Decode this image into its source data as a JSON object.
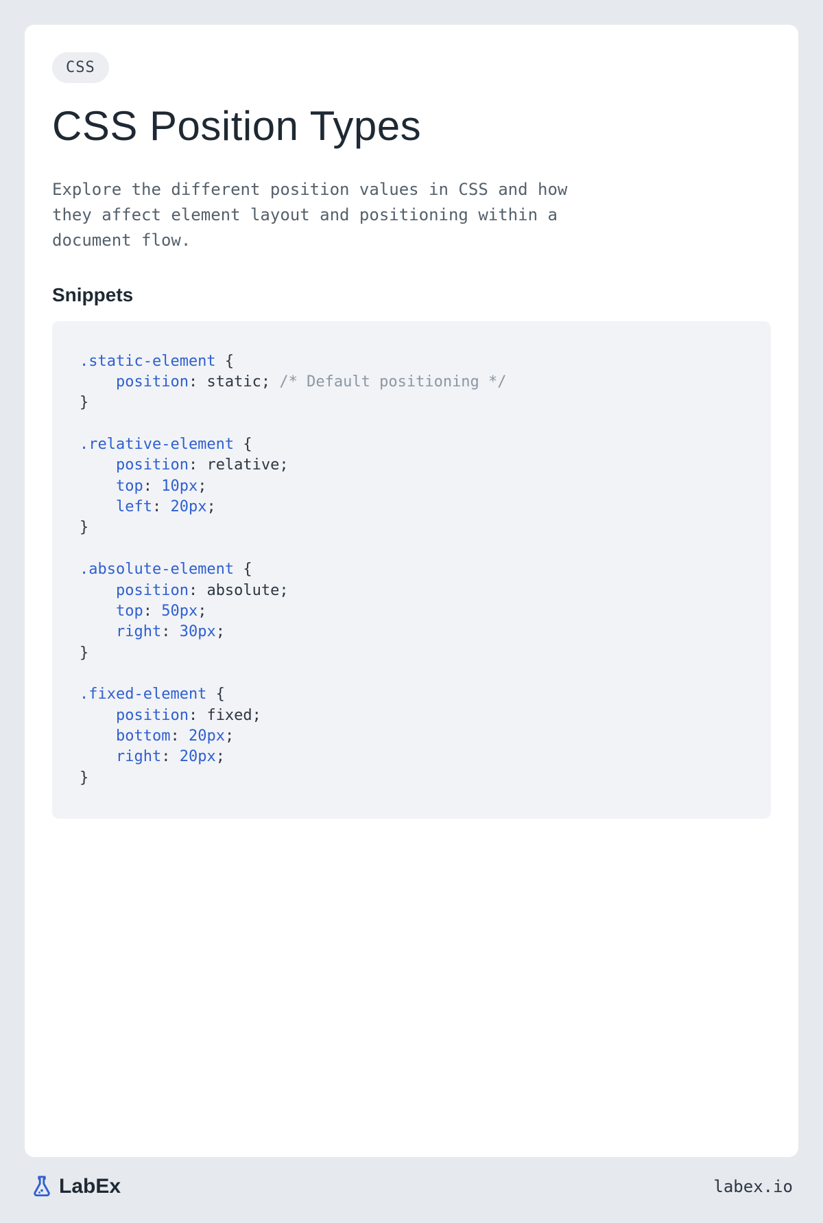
{
  "badge": "CSS",
  "title": "CSS Position Types",
  "description": "Explore the different position values in CSS and how they affect element layout and positioning within a document flow.",
  "section_heading": "Snippets",
  "code_tokens": [
    {
      "t": "sel",
      "v": ".static-element"
    },
    {
      "t": "p",
      "v": " {\n"
    },
    {
      "t": "p",
      "v": "    "
    },
    {
      "t": "prop",
      "v": "position"
    },
    {
      "t": "p",
      "v": ": static; "
    },
    {
      "t": "com",
      "v": "/* Default positioning */"
    },
    {
      "t": "p",
      "v": "\n}\n\n"
    },
    {
      "t": "sel",
      "v": ".relative-element"
    },
    {
      "t": "p",
      "v": " {\n"
    },
    {
      "t": "p",
      "v": "    "
    },
    {
      "t": "prop",
      "v": "position"
    },
    {
      "t": "p",
      "v": ": relative;\n"
    },
    {
      "t": "p",
      "v": "    "
    },
    {
      "t": "prop",
      "v": "top"
    },
    {
      "t": "p",
      "v": ": "
    },
    {
      "t": "num",
      "v": "10px"
    },
    {
      "t": "p",
      "v": ";\n"
    },
    {
      "t": "p",
      "v": "    "
    },
    {
      "t": "prop",
      "v": "left"
    },
    {
      "t": "p",
      "v": ": "
    },
    {
      "t": "num",
      "v": "20px"
    },
    {
      "t": "p",
      "v": ";\n}\n\n"
    },
    {
      "t": "sel",
      "v": ".absolute-element"
    },
    {
      "t": "p",
      "v": " {\n"
    },
    {
      "t": "p",
      "v": "    "
    },
    {
      "t": "prop",
      "v": "position"
    },
    {
      "t": "p",
      "v": ": absolute;\n"
    },
    {
      "t": "p",
      "v": "    "
    },
    {
      "t": "prop",
      "v": "top"
    },
    {
      "t": "p",
      "v": ": "
    },
    {
      "t": "num",
      "v": "50px"
    },
    {
      "t": "p",
      "v": ";\n"
    },
    {
      "t": "p",
      "v": "    "
    },
    {
      "t": "prop",
      "v": "right"
    },
    {
      "t": "p",
      "v": ": "
    },
    {
      "t": "num",
      "v": "30px"
    },
    {
      "t": "p",
      "v": ";\n}\n\n"
    },
    {
      "t": "sel",
      "v": ".fixed-element"
    },
    {
      "t": "p",
      "v": " {\n"
    },
    {
      "t": "p",
      "v": "    "
    },
    {
      "t": "prop",
      "v": "position"
    },
    {
      "t": "p",
      "v": ": fixed;\n"
    },
    {
      "t": "p",
      "v": "    "
    },
    {
      "t": "prop",
      "v": "bottom"
    },
    {
      "t": "p",
      "v": ": "
    },
    {
      "t": "num",
      "v": "20px"
    },
    {
      "t": "p",
      "v": ";\n"
    },
    {
      "t": "p",
      "v": "    "
    },
    {
      "t": "prop",
      "v": "right"
    },
    {
      "t": "p",
      "v": ": "
    },
    {
      "t": "num",
      "v": "20px"
    },
    {
      "t": "p",
      "v": ";\n}"
    }
  ],
  "token_colors": {
    "sel": "#2f5fd0",
    "prop": "#2f5fd0",
    "num": "#2f5fd0",
    "com": "#8a97a6",
    "p": "#2d3642"
  },
  "brand": {
    "name": "LabEx",
    "site": "labex.io",
    "accent": "#2f5fd0"
  }
}
